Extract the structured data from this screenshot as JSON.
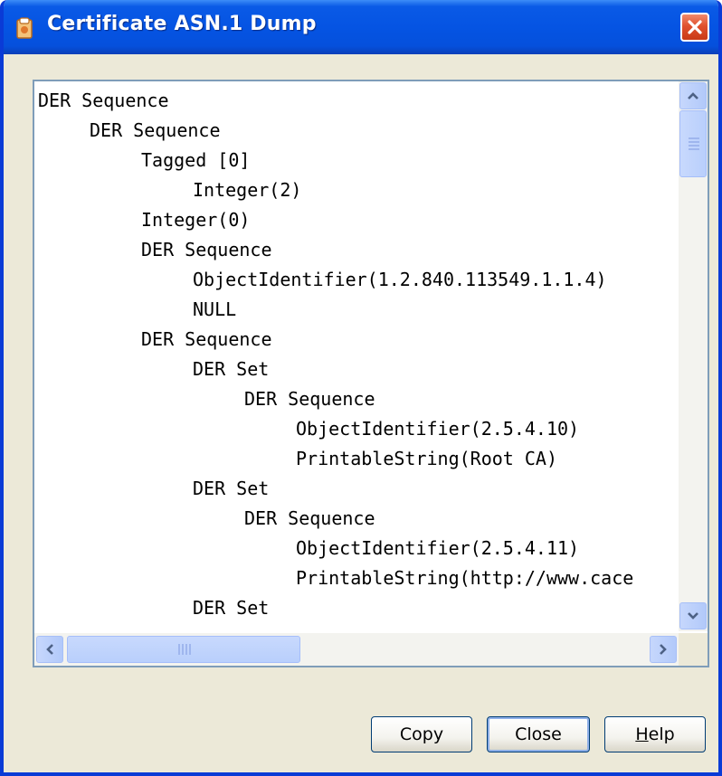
{
  "window": {
    "title": "Certificate ASN.1 Dump",
    "title_icon": "certificate-icon",
    "close_icon": "close-icon"
  },
  "asn1_dump": {
    "lines": [
      {
        "indent": 0,
        "text": "DER Sequence"
      },
      {
        "indent": 1,
        "text": "DER Sequence"
      },
      {
        "indent": 2,
        "text": "Tagged [0]"
      },
      {
        "indent": 3,
        "text": "Integer(2)"
      },
      {
        "indent": 2,
        "text": "Integer(0)"
      },
      {
        "indent": 2,
        "text": "DER Sequence"
      },
      {
        "indent": 3,
        "text": "ObjectIdentifier(1.2.840.113549.1.1.4)"
      },
      {
        "indent": 3,
        "text": "NULL"
      },
      {
        "indent": 2,
        "text": "DER Sequence"
      },
      {
        "indent": 3,
        "text": "DER Set"
      },
      {
        "indent": 4,
        "text": "DER Sequence"
      },
      {
        "indent": 5,
        "text": "ObjectIdentifier(2.5.4.10)"
      },
      {
        "indent": 5,
        "text": "PrintableString(Root CA)"
      },
      {
        "indent": 3,
        "text": "DER Set"
      },
      {
        "indent": 4,
        "text": "DER Sequence"
      },
      {
        "indent": 5,
        "text": "ObjectIdentifier(2.5.4.11)"
      },
      {
        "indent": 5,
        "text": "PrintableString(http://www.cace"
      },
      {
        "indent": 3,
        "text": "DER Set"
      }
    ]
  },
  "scrollbars": {
    "vertical_up_icon": "chevron-up-icon",
    "vertical_down_icon": "chevron-down-icon",
    "horizontal_left_icon": "chevron-left-icon",
    "horizontal_right_icon": "chevron-right-icon"
  },
  "buttons": {
    "copy": "Copy",
    "close": "Close",
    "help_accel": "H",
    "help_rest": "elp"
  },
  "colors": {
    "titlebar": "#0554e3",
    "dialog_bg": "#ece9d8",
    "close_button": "#e0512e",
    "listbox_border": "#7f9db9"
  }
}
